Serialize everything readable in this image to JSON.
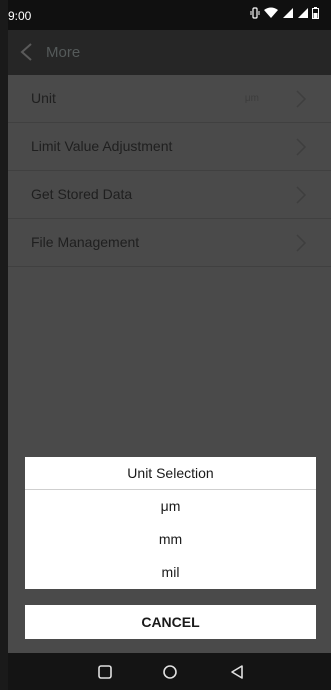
{
  "status_bar": {
    "time": "9:00",
    "icons": [
      "vibrate-icon",
      "wifi-icon",
      "signal-icon",
      "signal-icon",
      "battery-icon"
    ]
  },
  "app_bar": {
    "back_icon": "chevron-left-icon",
    "title": "More"
  },
  "menu": {
    "items": [
      {
        "label": "Unit",
        "value": "μm"
      },
      {
        "label": "Limit Value Adjustment",
        "value": ""
      },
      {
        "label": "Get Stored Data",
        "value": ""
      },
      {
        "label": "File Management",
        "value": ""
      }
    ]
  },
  "dialog": {
    "title": "Unit Selection",
    "options": [
      "μm",
      "mm",
      "mil"
    ],
    "cancel_label": "CANCEL"
  },
  "nav_bar": {
    "buttons": [
      "recents-icon",
      "home-icon",
      "back-icon"
    ]
  },
  "colors": {
    "overlay": "#4a4a4a",
    "app_bar": "#262626",
    "status_bar": "#101010",
    "dialog": "#ffffff"
  }
}
